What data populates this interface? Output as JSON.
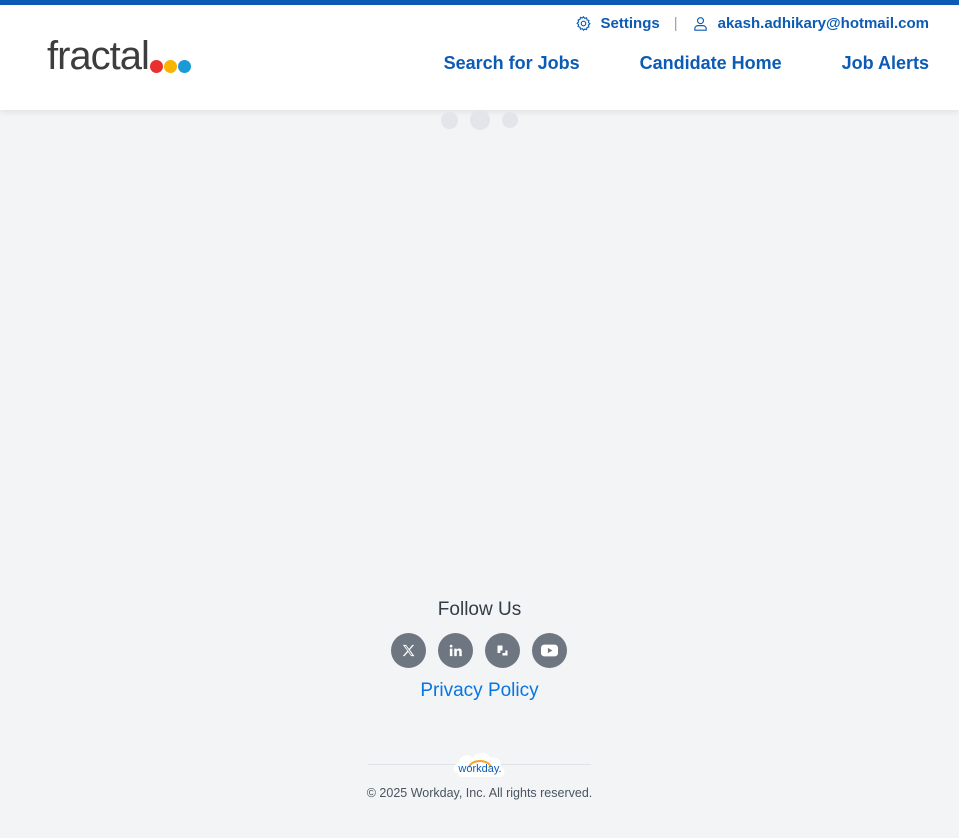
{
  "header": {
    "logo_text": "fractal",
    "logo_dot_colors": [
      "#e8312f",
      "#f7b500",
      "#1a9ad6"
    ],
    "settings_label": "Settings",
    "user_email": "akash.adhikary@hotmail.com",
    "separator": "|",
    "nav": [
      {
        "label": "Search for Jobs"
      },
      {
        "label": "Candidate Home"
      },
      {
        "label": "Job Alerts"
      }
    ]
  },
  "footer": {
    "follow_us": "Follow Us",
    "social_icons": [
      "x-twitter-icon",
      "linkedin-icon",
      "glassdoor-icon",
      "youtube-icon"
    ],
    "privacy_policy": "Privacy Policy",
    "workday_logo_text": "workday.",
    "copyright": "© 2025 Workday, Inc. All rights reserved."
  },
  "colors": {
    "accent": "#0c5bb4",
    "link": "#0875e1",
    "social_bg": "#6e7781",
    "page_bg": "#f2f4f5"
  }
}
